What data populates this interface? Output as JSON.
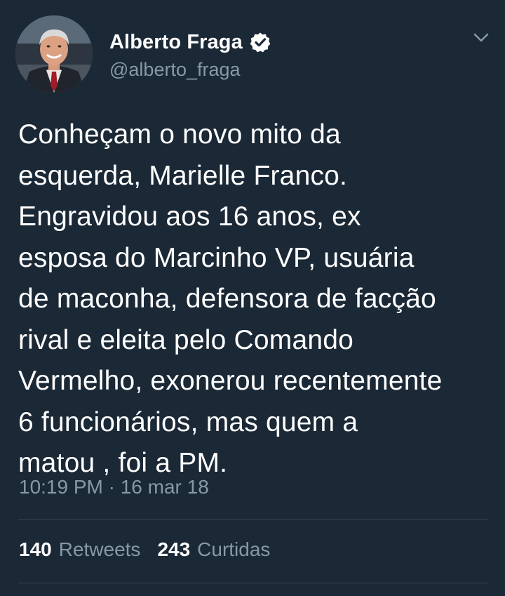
{
  "author": {
    "display_name": "Alberto Fraga",
    "handle": "@alberto_fraga",
    "verified": true,
    "avatar_icon": "profile-photo"
  },
  "tweet": {
    "text": "Conheçam o novo mito da\nesquerda, Marielle Franco.\nEngravidou aos 16 anos, ex\nesposa do Marcinho VP, usuária\nde maconha, defensora de facção\nrival e eleita pelo Comando\nVermelho, exonerou recentemente\n6 funcionários, mas quem a\nmatou , foi a PM.",
    "timestamp": "10:19 PM · 16 mar 18"
  },
  "stats": {
    "retweets_count": "140",
    "retweets_label": "Retweets",
    "likes_count": "243",
    "likes_label": "Curtidas"
  },
  "colors": {
    "background": "#1b2836",
    "text_primary": "#ffffff",
    "text_secondary": "#8899a6",
    "divider": "#38444d",
    "verified_badge": "#ffffff"
  }
}
